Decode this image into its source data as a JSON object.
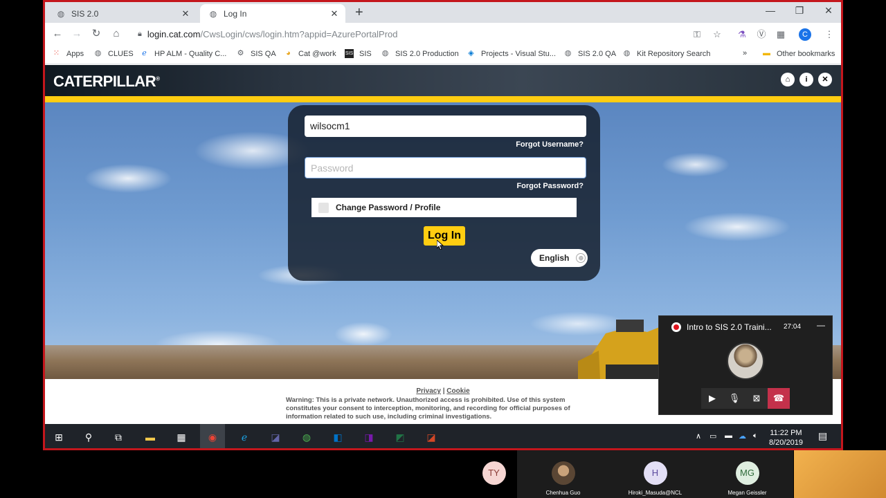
{
  "browser": {
    "tabs": [
      {
        "title": "SIS 2.0",
        "active": false
      },
      {
        "title": "Log In",
        "active": true
      }
    ],
    "url_host": "login.cat.com",
    "url_path": "/CwsLogin/cws/login.htm?appid=AzurePortalProd",
    "profile_initial": "C",
    "bookmarks": [
      "Apps",
      "CLUES",
      "HP ALM - Quality C...",
      "SIS QA",
      "Cat @work",
      "SIS",
      "SIS 2.0 Production",
      "Projects - Visual Stu...",
      "SIS 2.0 QA",
      "Kit Repository Search"
    ],
    "other_bookmarks": "Other bookmarks",
    "overflow": "»"
  },
  "page": {
    "logo_text": "CATERPILLAR",
    "logo_mark": "®",
    "username_value": "wilsocm1",
    "password_placeholder": "Password",
    "forgot_username": "Forgot Username?",
    "forgot_password": "Forgot Password?",
    "change_password_label": "Change Password / Profile",
    "login_label": "Log In",
    "language": "English",
    "footer_privacy": "Privacy",
    "footer_sep": " | ",
    "footer_cookie": "Cookie",
    "footer_warning": "Warning: This is a private network. Unauthorized access is prohibited. Use of this system constitutes your consent to interception, monitoring, and recording for official purposes of information related to such use, including criminal investigations.",
    "colors": {
      "cat_yellow": "#ffcd11",
      "header_dark": "#26303a"
    }
  },
  "taskbar": {
    "time": "11:22 PM",
    "date": "8/20/2019"
  },
  "teams_call": {
    "title": "Intro to SIS 2.0 Traini...",
    "elapsed": "27:04"
  },
  "participants": [
    {
      "initials": "TY",
      "name": ""
    },
    {
      "initials": "",
      "name": "Chenhua Guo"
    },
    {
      "initials": "H",
      "name": "Hiroki_Masuda@NCL"
    },
    {
      "initials": "MG",
      "name": "Megan Geissler"
    }
  ]
}
